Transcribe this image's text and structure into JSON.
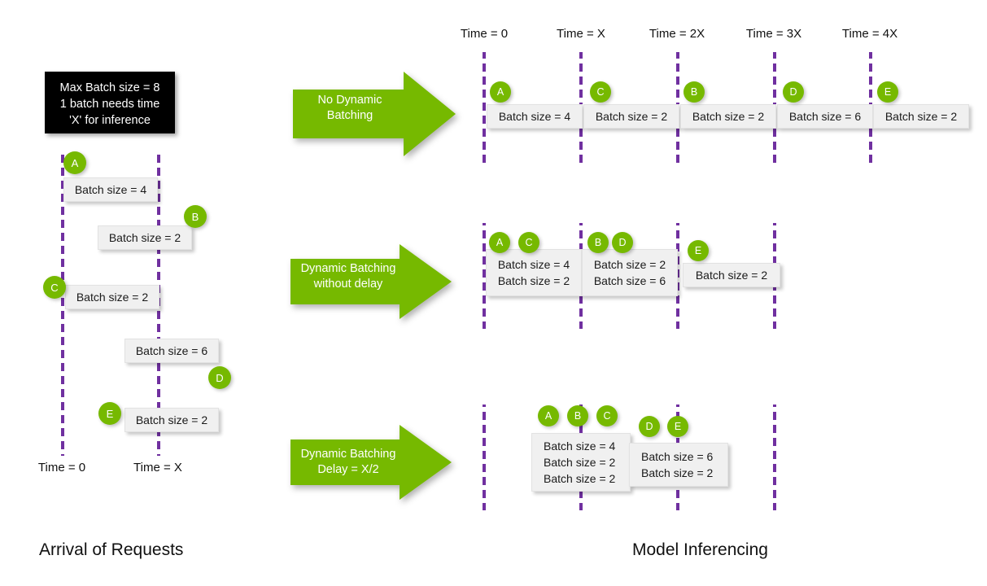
{
  "title": "Dynamic Batching Illustration",
  "colors": {
    "green": "#76b900",
    "purple": "#7030A0",
    "box_fill": "#f0f0f0",
    "info_bg": "#000000"
  },
  "info_box": {
    "line1": "Max Batch size = 8",
    "line2": "1 batch needs time",
    "line3": "'X' for inference"
  },
  "captions": {
    "left": "Arrival of Requests",
    "right": "Model Inferencing"
  },
  "left_panel": {
    "time_labels": [
      {
        "label": "Time = 0"
      },
      {
        "label": "Time = X"
      }
    ],
    "requests": [
      {
        "id": "A",
        "text": "Batch size = 4"
      },
      {
        "id": "B",
        "text": "Batch size = 2"
      },
      {
        "id": "C",
        "text": "Batch size = 2"
      },
      {
        "id": "D",
        "text": "Batch size = 6"
      },
      {
        "id": "E",
        "text": "Batch size = 2"
      }
    ]
  },
  "right_panel": {
    "time_labels": [
      {
        "label": "Time = 0"
      },
      {
        "label": "Time = X"
      },
      {
        "label": "Time = 2X"
      },
      {
        "label": "Time = 3X"
      },
      {
        "label": "Time = 4X"
      }
    ],
    "rows": [
      {
        "arrow_line1": "No Dynamic",
        "arrow_line2": "Batching",
        "slots": [
          {
            "markers": [
              "A"
            ],
            "batches": [
              "Batch size = 4"
            ]
          },
          {
            "markers": [
              "C"
            ],
            "batches": [
              "Batch size = 2"
            ]
          },
          {
            "markers": [
              "B"
            ],
            "batches": [
              "Batch size = 2"
            ]
          },
          {
            "markers": [
              "D"
            ],
            "batches": [
              "Batch size = 6"
            ]
          },
          {
            "markers": [
              "E"
            ],
            "batches": [
              "Batch size = 2"
            ]
          }
        ]
      },
      {
        "arrow_line1": "Dynamic Batching",
        "arrow_line2": "without delay",
        "slots": [
          {
            "markers": [
              "A",
              "C"
            ],
            "batches": [
              "Batch size = 4",
              "Batch size = 2"
            ]
          },
          {
            "markers": [
              "B",
              "D"
            ],
            "batches": [
              "Batch size = 2",
              "Batch size = 6"
            ]
          },
          {
            "markers": [
              "E"
            ],
            "batches": [
              "Batch size = 2"
            ]
          }
        ]
      },
      {
        "arrow_line1": "Dynamic Batching",
        "arrow_line2": "Delay = X/2",
        "slots": [
          {
            "markers": [
              "A",
              "B",
              "C"
            ],
            "batches": [
              "Batch size = 4",
              "Batch size = 2",
              "Batch size = 2"
            ]
          },
          {
            "markers": [
              "D",
              "E"
            ],
            "batches": [
              "Batch size = 6",
              "Batch size = 2"
            ]
          }
        ]
      }
    ]
  }
}
